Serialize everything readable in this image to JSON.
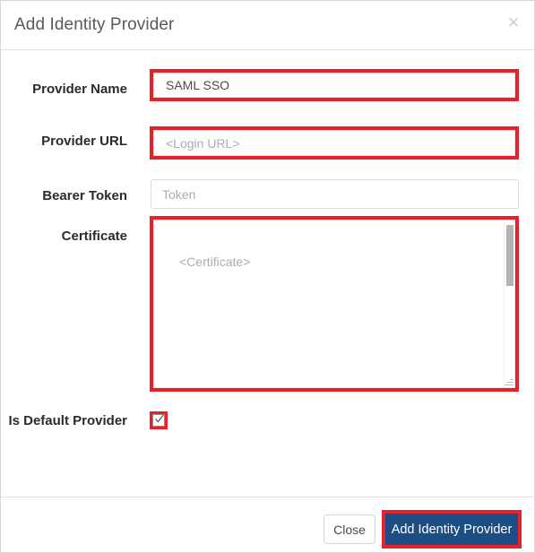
{
  "dialog": {
    "title": "Add Identity Provider",
    "close_icon": "close-x-icon"
  },
  "form": {
    "fields": [
      {
        "label": "Provider Name",
        "value": "SAML SSO",
        "placeholder": "",
        "type": "text",
        "highlighted": true
      },
      {
        "label": "Provider URL",
        "value": "",
        "placeholder": "<Login URL>",
        "type": "text",
        "highlighted": true
      },
      {
        "label": "Bearer Token",
        "value": "",
        "placeholder": "Token",
        "type": "text",
        "highlighted": false
      },
      {
        "label": "Certificate",
        "value": "",
        "placeholder": "<Certificate>",
        "type": "textarea",
        "highlighted": true
      },
      {
        "label": "Is Default Provider",
        "value": "checked",
        "type": "checkbox",
        "highlighted": true
      }
    ]
  },
  "footer": {
    "close_label": "Close",
    "submit_label": "Add Identity Provider"
  },
  "colors": {
    "highlight_red": "#e8202c",
    "primary_blue": "#1c4e84",
    "label_text": "#2b2b2b",
    "placeholder_text": "#a9adb1",
    "title_text": "#555a5f"
  }
}
